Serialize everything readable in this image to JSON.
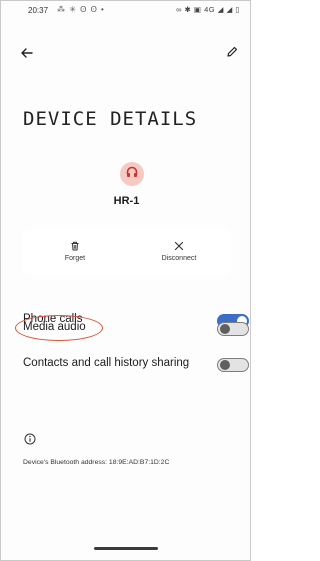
{
  "status_bar": {
    "time": "20:37",
    "notifications": "⁂ ✳ ʘ ʘ •",
    "system": "∞ ✱ ▣ 4G ◢ ◢ ▯"
  },
  "header": {
    "title": "DEVICE DETAILS"
  },
  "device": {
    "name": "HR-1",
    "avatar_color": "#f6c9c2",
    "icon_color": "#c4352e"
  },
  "actions": {
    "forget_label": "Forget",
    "disconnect_label": "Disconnect"
  },
  "settings": [
    {
      "label": "Phone calls",
      "enabled": true
    },
    {
      "label": "Media audio",
      "enabled": false,
      "highlighted": true
    },
    {
      "label": "Contacts and call history sharing",
      "enabled": false
    }
  ],
  "footer": {
    "bt_address": "Device's Bluetooth address: 18:9E:AD:B7:1D:2C"
  },
  "colors": {
    "accent": "#3b6fc6",
    "highlight": "#d9533b"
  }
}
